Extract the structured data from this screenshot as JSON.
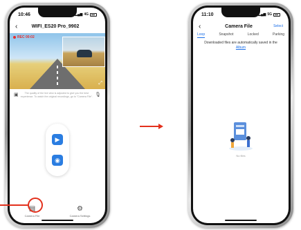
{
  "left_phone": {
    "status_time": "10:46",
    "network": "4G",
    "title": "WIFI_ES20 Pro_9902",
    "rec_label": "REC 00:02",
    "hint": "The quality of the live view is adjusted to give you the best experience. To watch the original recordings, go to \"Camera File\".",
    "tabs": [
      {
        "label": "Camera File",
        "icon": "sd-card-icon"
      },
      {
        "label": "Camera Settings",
        "icon": "gear-icon"
      }
    ]
  },
  "right_phone": {
    "status_time": "11:10",
    "network": "5G",
    "title": "Camera File",
    "select_label": "Select",
    "tabs": [
      "Loop",
      "Snapshot",
      "Locked",
      "Parking"
    ],
    "notice": "Downloaded files are automatically saved in the",
    "album_link": "Album",
    "empty_text": "No files"
  },
  "colors": {
    "accent": "#2a7de1",
    "highlight": "#e3301c",
    "link": "#1a6ee8"
  }
}
